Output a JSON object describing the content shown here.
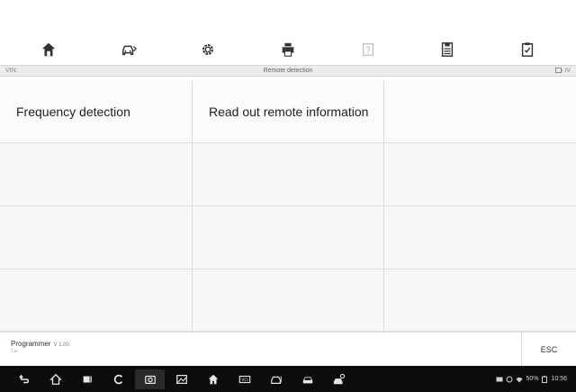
{
  "toolbar": {
    "items": [
      {
        "name": "home-icon"
      },
      {
        "name": "vehicle-swap-icon"
      },
      {
        "name": "settings-icon"
      },
      {
        "name": "print-icon"
      },
      {
        "name": "help-icon",
        "disabled": true
      },
      {
        "name": "data-save-icon"
      },
      {
        "name": "data-logging-icon"
      }
    ]
  },
  "titlebar": {
    "vin": "VIN:",
    "title": "Remote detection",
    "battery": "IV"
  },
  "functions": {
    "cells": [
      "Frequency detection",
      "Read out remote information",
      "",
      "",
      "",
      "",
      "",
      "",
      "",
      "",
      "",
      ""
    ]
  },
  "footer": {
    "program": "Programmer",
    "version": "V 1.00",
    "sub": "Car",
    "esc_label": "ESC"
  },
  "navbar": {
    "battery_pct": "50%",
    "time": "10:56"
  },
  "colors": {
    "grid_bg": "#f7f7f7",
    "titlebar_bg": "#ececec",
    "navbar_bg": "#0c0c0c"
  }
}
